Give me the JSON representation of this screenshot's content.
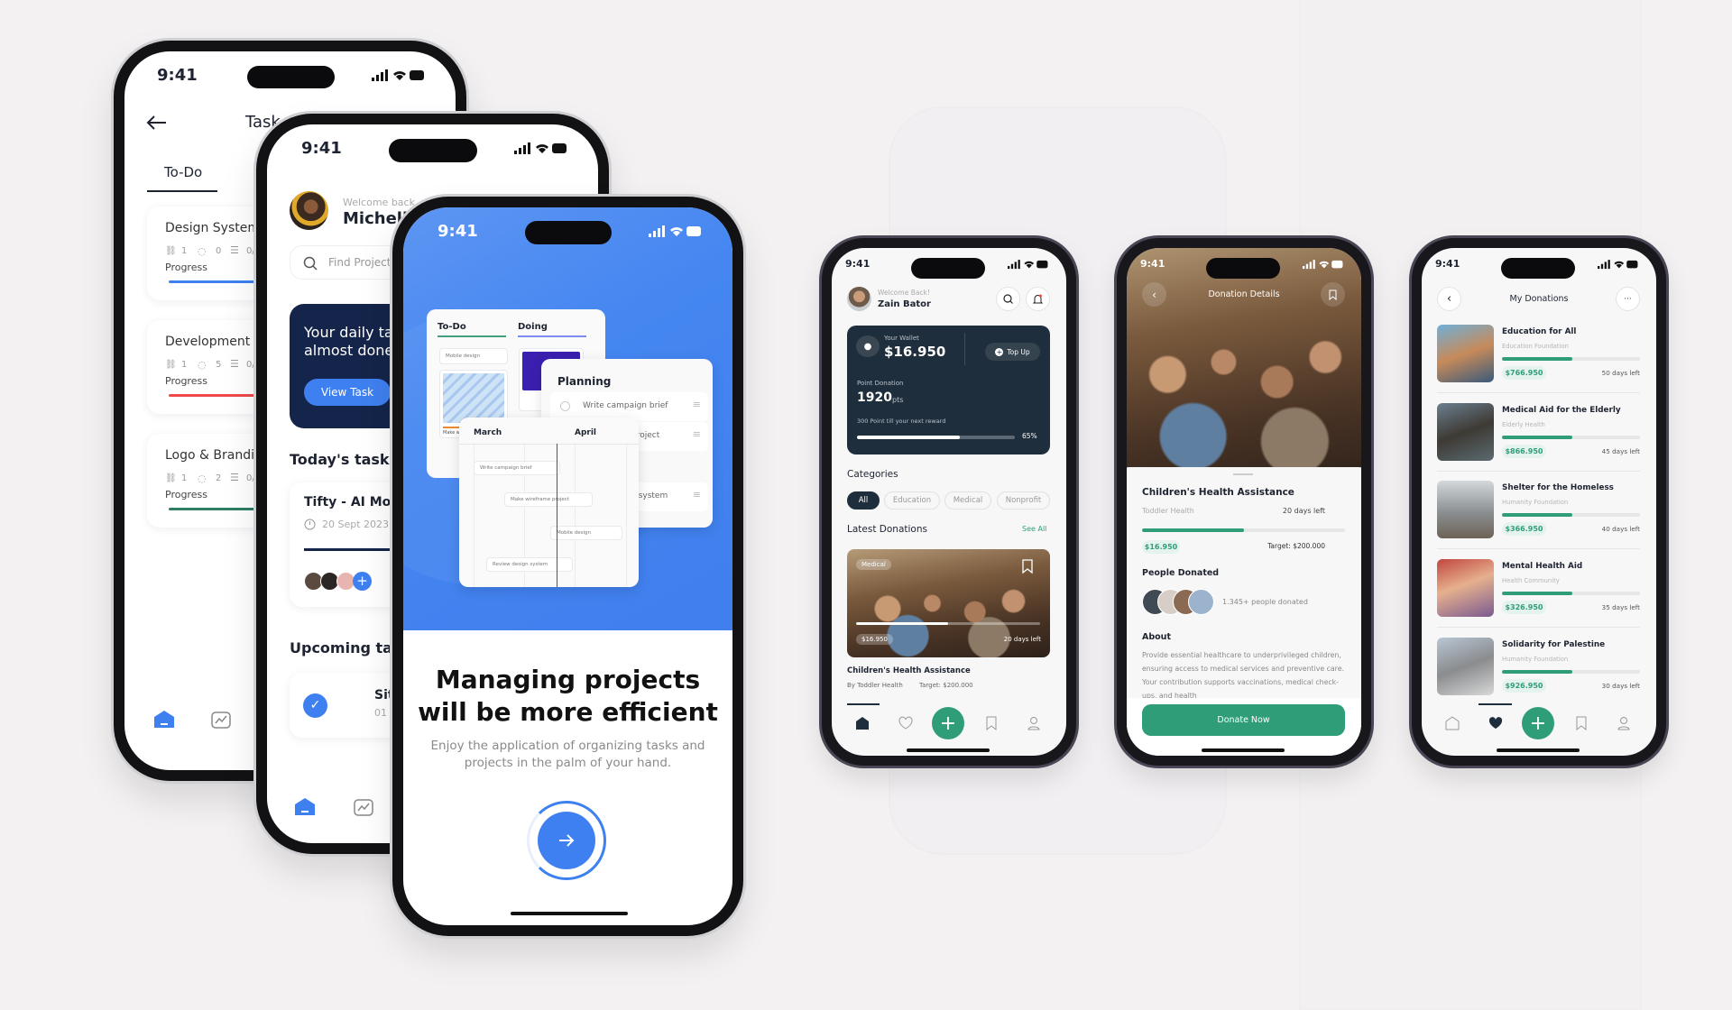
{
  "colors": {
    "task_blue": "#3f80f0",
    "navy": "#14244a",
    "donation_green": "#2f9e78",
    "wallet_dark": "#1f2e3c",
    "background": "#f3f1f2"
  },
  "status_time": "9:41",
  "task_list_screen": {
    "title": "Task",
    "active_tab": "To-Do",
    "progress_label": "Progress",
    "tasks": [
      {
        "name": "Design System",
        "links": "1",
        "comments": "0",
        "checklist": "0/",
        "bar_color": "#3f80f0"
      },
      {
        "name": "Development We",
        "links": "1",
        "comments": "5",
        "checklist": "0/",
        "bar_color": "#ef4a4a"
      },
      {
        "name": "Logo & Branding",
        "links": "1",
        "comments": "2",
        "checklist": "0/",
        "bar_color": "#2f7d64"
      }
    ]
  },
  "home_screen": {
    "welcome": "Welcome back,",
    "user_name": "Michelle",
    "search_placeholder": "Find Project",
    "banner_line1": "Your daily task",
    "banner_line2": "almost done",
    "view_task_button": "View Task",
    "todays_task_heading": "Today's task",
    "today_task": {
      "title": "Tifty - AI Mob",
      "date": "20 Sept 2023"
    },
    "upcoming_heading": "Upcoming task",
    "upcoming_item": {
      "title": "Sit",
      "date": "01 J"
    }
  },
  "onboarding_screen": {
    "kanban": {
      "col1": "To-Do",
      "col2": "Doing",
      "card1": "Mobile design",
      "card2": "Make w"
    },
    "planning": {
      "title": "Planning",
      "items": [
        "Write campaign brief",
        "Make wireframe project",
        "Review design system"
      ]
    },
    "timeline": {
      "month1": "March",
      "month2": "April",
      "tasks": [
        "Write campaign brief",
        "Make wireframe project",
        "Mobile design",
        "Review design system"
      ]
    },
    "headline_line1": "Managing projects",
    "headline_line2": "will be more efficient",
    "subtitle_line1": "Enjoy the application of organizing tasks and",
    "subtitle_line2": "projects in the palm of your hand.",
    "next_icon": "arrow-right-icon"
  },
  "wallet_screen": {
    "welcome": "Welcome Back!",
    "user_name": "Zain Bator",
    "wallet_label": "Your Wallet",
    "wallet_amount": "$16.950",
    "top_up_button": "Top Up",
    "points_label": "Point Donation",
    "points_value": "1920",
    "points_unit": "pts",
    "reward_note": "300 Point till your next reward",
    "reward_progress_percent": 65,
    "reward_progress_label": "65%",
    "categories_heading": "Categories",
    "categories": [
      "All",
      "Education",
      "Medical",
      "Nonprofit"
    ],
    "selected_category": "All",
    "latest_heading": "Latest Donations",
    "see_all": "See All",
    "featured": {
      "tag": "Medical",
      "raised": "$16.950",
      "days_left": "20 days left",
      "progress_percent": 50,
      "title": "Children's Health Assistance",
      "by": "By Toddler Health",
      "target": "Target: $200.000"
    }
  },
  "details_screen": {
    "title": "Donation Details",
    "campaign_title": "Children's Health Assistance",
    "organizer": "Toddler Health",
    "days_left": "20 days left",
    "progress_percent": 50,
    "raised": "$16.950",
    "target": "Target: $200.000",
    "people_heading": "People Donated",
    "people_count": "1.345+ people donated",
    "about_heading": "About",
    "about_text": "Provide essential healthcare to underprivileged children, ensuring access to medical services and preventive care. Your contribution supports vaccinations, medical check-ups, and health",
    "donate_button": "Donate Now"
  },
  "my_donations_screen": {
    "title": "My Donations",
    "items": [
      {
        "title": "Education for All",
        "org": "Education Foundation",
        "amount": "$766.950",
        "days_left": "50 days left",
        "progress_percent": 51
      },
      {
        "title": "Medical Aid for the Elderly",
        "org": "Elderly Health",
        "amount": "$866.950",
        "days_left": "45 days left",
        "progress_percent": 51
      },
      {
        "title": "Shelter for the Homeless",
        "org": "Humanity Foundation",
        "amount": "$366.950",
        "days_left": "40 days left",
        "progress_percent": 51
      },
      {
        "title": "Mental Health Aid",
        "org": "Health Community",
        "amount": "$326.950",
        "days_left": "35 days left",
        "progress_percent": 51
      },
      {
        "title": "Solidarity for Palestine",
        "org": "Humanity Foundation",
        "amount": "$926.950",
        "days_left": "30 days left",
        "progress_percent": 51
      }
    ]
  }
}
